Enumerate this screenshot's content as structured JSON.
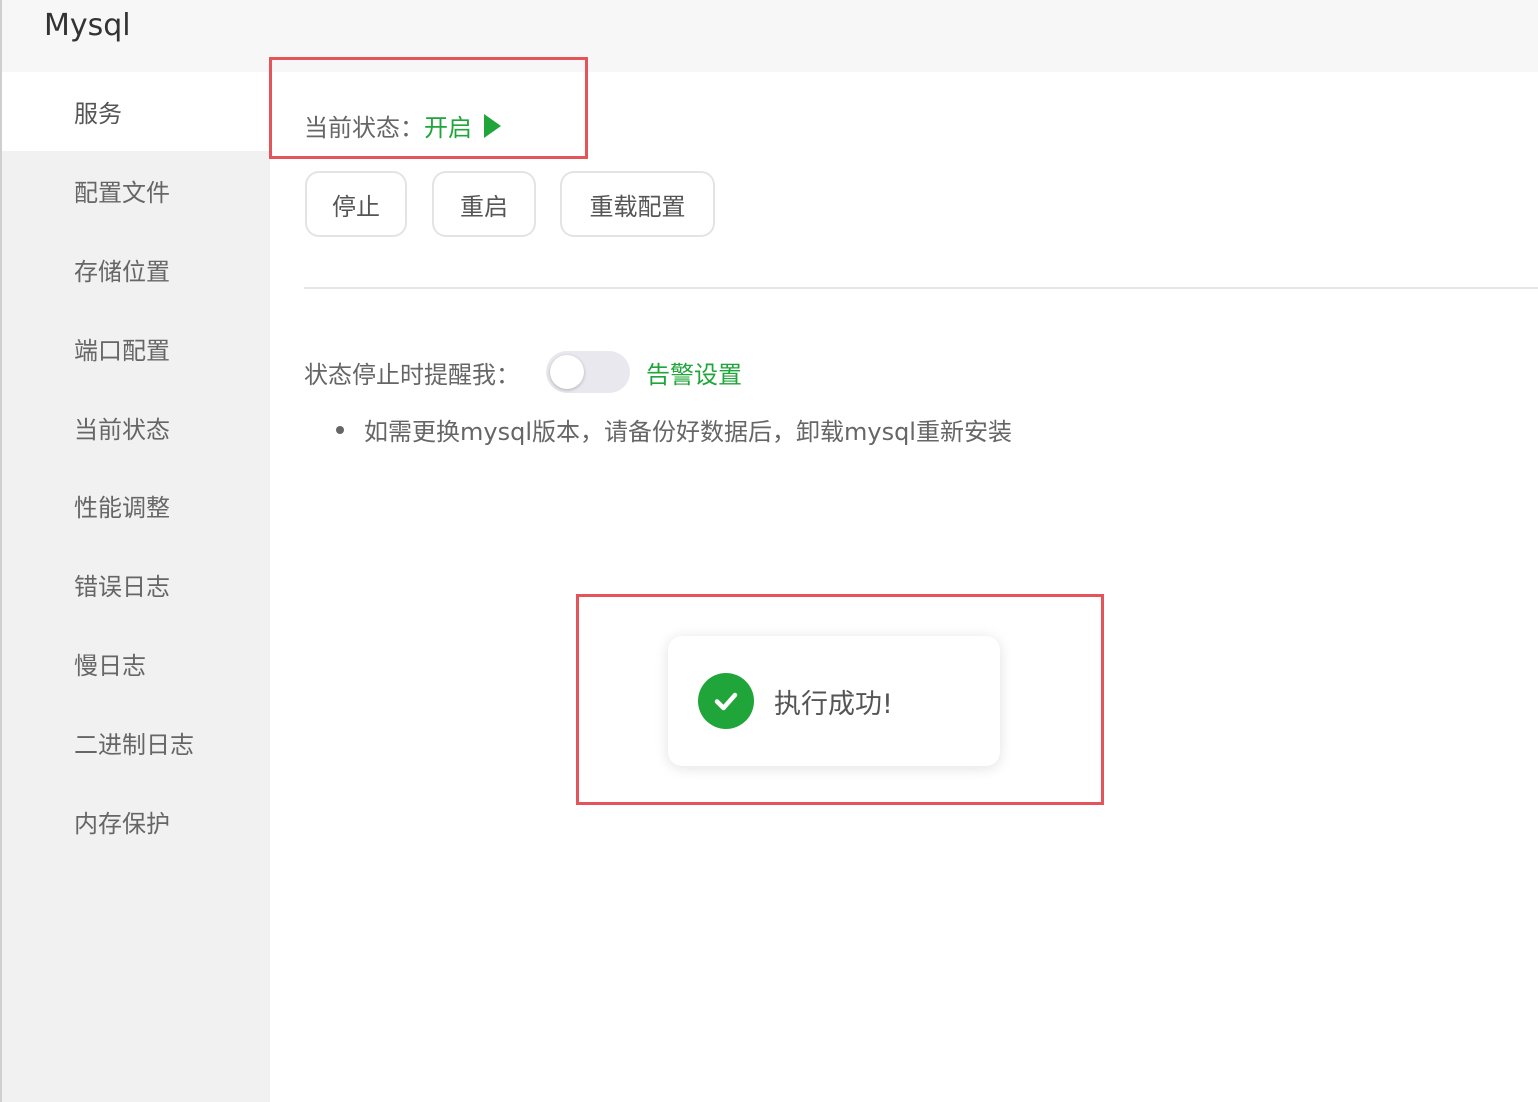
{
  "window": {
    "title": "Mysql"
  },
  "sidebar": {
    "items": [
      {
        "label": "服务",
        "active": true
      },
      {
        "label": "配置文件"
      },
      {
        "label": "存储位置"
      },
      {
        "label": "端口配置"
      },
      {
        "label": "当前状态"
      },
      {
        "label": "性能调整"
      },
      {
        "label": "错误日志"
      },
      {
        "label": "慢日志"
      },
      {
        "label": "二进制日志"
      },
      {
        "label": "内存保护"
      }
    ]
  },
  "service": {
    "status_label": "当前状态：",
    "status_value": "开启",
    "status_color": "#20a53a",
    "buttons": {
      "stop": "停止",
      "restart": "重启",
      "reload": "重载配置"
    },
    "alert_label": "状态停止时提醒我：",
    "alert_toggle_on": false,
    "alert_link": "告警设置",
    "note": "如需更换mysql版本，请备份好数据后，卸载mysql重新安装"
  },
  "toast": {
    "message": "执行成功!",
    "icon": "check-circle-icon"
  },
  "highlight_color": "#e5545a"
}
